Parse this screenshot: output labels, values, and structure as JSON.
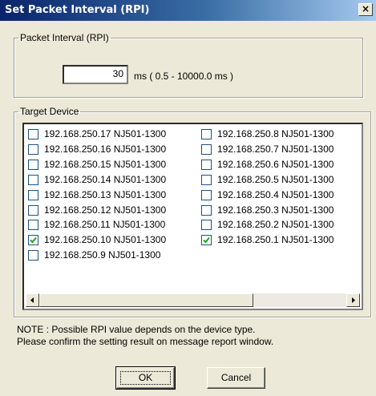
{
  "dialog": {
    "title": "Set Packet Interval (RPI)",
    "close_label": "×"
  },
  "rpi_group": {
    "legend": "Packet Interval (RPI)",
    "value": "30",
    "range_text": "ms ( 0.5 - 10000.0 ms )"
  },
  "target_group": {
    "legend": "Target Device",
    "devices": [
      {
        "label": "192.168.250.17 NJ501-1300",
        "checked": false
      },
      {
        "label": "192.168.250.16 NJ501-1300",
        "checked": false
      },
      {
        "label": "192.168.250.15 NJ501-1300",
        "checked": false
      },
      {
        "label": "192.168.250.14 NJ501-1300",
        "checked": false
      },
      {
        "label": "192.168.250.13 NJ501-1300",
        "checked": false
      },
      {
        "label": "192.168.250.12 NJ501-1300",
        "checked": false
      },
      {
        "label": "192.168.250.11 NJ501-1300",
        "checked": false
      },
      {
        "label": "192.168.250.10 NJ501-1300",
        "checked": true
      },
      {
        "label": "192.168.250.9 NJ501-1300",
        "checked": false
      },
      {
        "label": "192.168.250.8 NJ501-1300",
        "checked": false
      },
      {
        "label": "192.168.250.7 NJ501-1300",
        "checked": false
      },
      {
        "label": "192.168.250.6 NJ501-1300",
        "checked": false
      },
      {
        "label": "192.168.250.5 NJ501-1300",
        "checked": false
      },
      {
        "label": "192.168.250.4 NJ501-1300",
        "checked": false
      },
      {
        "label": "192.168.250.3 NJ501-1300",
        "checked": false
      },
      {
        "label": "192.168.250.2 NJ501-1300",
        "checked": false
      },
      {
        "label": "192.168.250.1 NJ501-1300",
        "checked": true
      }
    ]
  },
  "note": {
    "line1": "NOTE : Possible RPI value depends on the device type.",
    "line2": "Please confirm the setting result on message report window."
  },
  "buttons": {
    "ok": "OK",
    "cancel": "Cancel"
  }
}
